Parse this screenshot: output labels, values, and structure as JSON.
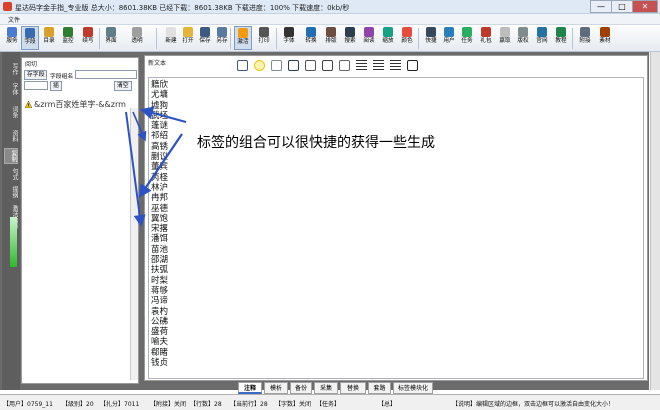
{
  "window": {
    "title": "星达码字金手指_专业版   总大小：8601.38KB 已经下载：8601.38KB 下载进度：100% 下载速度：0kb/秒",
    "controls": [
      "—",
      "□",
      "✕"
    ]
  },
  "menubar": {
    "file": "文件"
  },
  "toolbar": [
    {
      "label": "服务",
      "icon": "service-icon",
      "color": "#4a7bd0"
    },
    {
      "label": "字段",
      "icon": "field-icon",
      "color": "#3a6ab0",
      "active": true
    },
    {
      "label": "目录",
      "icon": "directory-icon",
      "color": "#d9a12b"
    },
    {
      "label": "监控",
      "icon": "monitor-icon",
      "color": "#2e7d32"
    },
    {
      "label": "续写",
      "icon": "continue-write-icon",
      "color": "#c0392b"
    },
    {
      "label": "界面",
      "icon": "interface-icon",
      "color": "#607d8b"
    },
    {
      "label": "透明",
      "icon": "transparent-icon",
      "color": "#9e9e9e"
    },
    {
      "label": "新建",
      "icon": "new-icon",
      "color": "#e0e0e0"
    },
    {
      "label": "打开",
      "icon": "open-icon",
      "color": "#e3b53b"
    },
    {
      "label": "保存",
      "icon": "save-icon",
      "color": "#3d5a80"
    },
    {
      "label": "另存",
      "icon": "save-as-icon",
      "color": "#5c7aa0"
    },
    {
      "label": "激活",
      "icon": "activate-icon",
      "color": "#f39c12",
      "active": true
    },
    {
      "label": "打印",
      "icon": "print-icon",
      "color": "#555555"
    },
    {
      "label": "字体",
      "icon": "font-icon",
      "color": "#333333"
    },
    {
      "label": "转换",
      "icon": "convert-icon",
      "color": "#1f6fb2"
    },
    {
      "label": "排版",
      "icon": "layout-icon",
      "color": "#6d4c41"
    },
    {
      "label": "搜索",
      "icon": "search-icon",
      "color": "#2c3e50"
    },
    {
      "label": "阅读",
      "icon": "read-icon",
      "color": "#8e44ad"
    },
    {
      "label": "缩放",
      "icon": "zoom-icon",
      "color": "#16a085"
    },
    {
      "label": "颜色",
      "icon": "color-icon",
      "color": "#e74c3c"
    },
    {
      "label": "快捷",
      "icon": "shortcut-icon",
      "color": "#34495e"
    },
    {
      "label": "用户",
      "icon": "user-icon",
      "color": "#2980b9"
    },
    {
      "label": "任务",
      "icon": "task-icon",
      "color": "#27ae60"
    },
    {
      "label": "礼包",
      "icon": "gift-icon",
      "color": "#c0392b"
    },
    {
      "label": "赢取",
      "icon": "win-icon",
      "color": "#bdbdbd"
    },
    {
      "label": "版权",
      "icon": "copyright-icon",
      "color": "#7f8c8d"
    },
    {
      "label": "官网",
      "icon": "website-icon",
      "color": "#2471a3"
    },
    {
      "label": "教程",
      "icon": "tutorial-icon",
      "color": "#1e8449"
    },
    {
      "label": "附接",
      "icon": "attach-icon",
      "color": "#5d6d7e"
    },
    {
      "label": "素材",
      "icon": "material-icon",
      "color": "#a04000"
    }
  ],
  "sidebar_tabs": [
    "写作",
    "字体",
    "词条",
    "资料",
    "复制",
    "句式",
    "提纲",
    "激活内容"
  ],
  "left_panel": {
    "title": "阅切",
    "save_button": "存字段",
    "field_name_label": "字段组名",
    "insert_button": "插",
    "clear_button": "清空",
    "item": "&zrm百家姓单字-&&zrm"
  },
  "right_panel": {
    "title": "新文本",
    "format_icons": [
      "save-icon",
      "bulb-icon",
      "document-icon",
      "back-arrow-icon",
      "cut-icon",
      "copy-icon",
      "paste-icon",
      "align-left-icon",
      "align-center-icon",
      "align-right-icon",
      "fullscreen-icon"
    ],
    "lines": [
      "籍欣",
      "尤墉",
      "墟狗",
      "武坯",
      "蓬谜",
      "祁绍",
      "高锈",
      "蒯议",
      "董宾",
      "芮柽",
      "林沪",
      "冉邦",
      "巫德",
      "翼饱",
      "宋撂",
      "潘饵",
      "苗池",
      "邵湖",
      "扶弧",
      "时梨",
      "蒋够",
      "冯谛",
      "袁杓",
      "公砩",
      "盛荷",
      "喻夫",
      "郗睹",
      "钱贞"
    ],
    "annotation": "标签的组合可以很快捷的获得一些生成"
  },
  "bottom_tabs": [
    "注释",
    "模析",
    "备份",
    "采集",
    "替换",
    "套路",
    "标签模块化"
  ],
  "bottom_active": 0,
  "status": [
    "【用户】0759_11",
    "【级别】20",
    "【扎分】7011",
    "【附接】关闭",
    "【行数】28",
    "【当前行】28",
    "【字数】关闭",
    "【任务】",
    "【总】",
    "【说明】编辑区域的边框，双击边框可以激活自由变化大小！"
  ]
}
